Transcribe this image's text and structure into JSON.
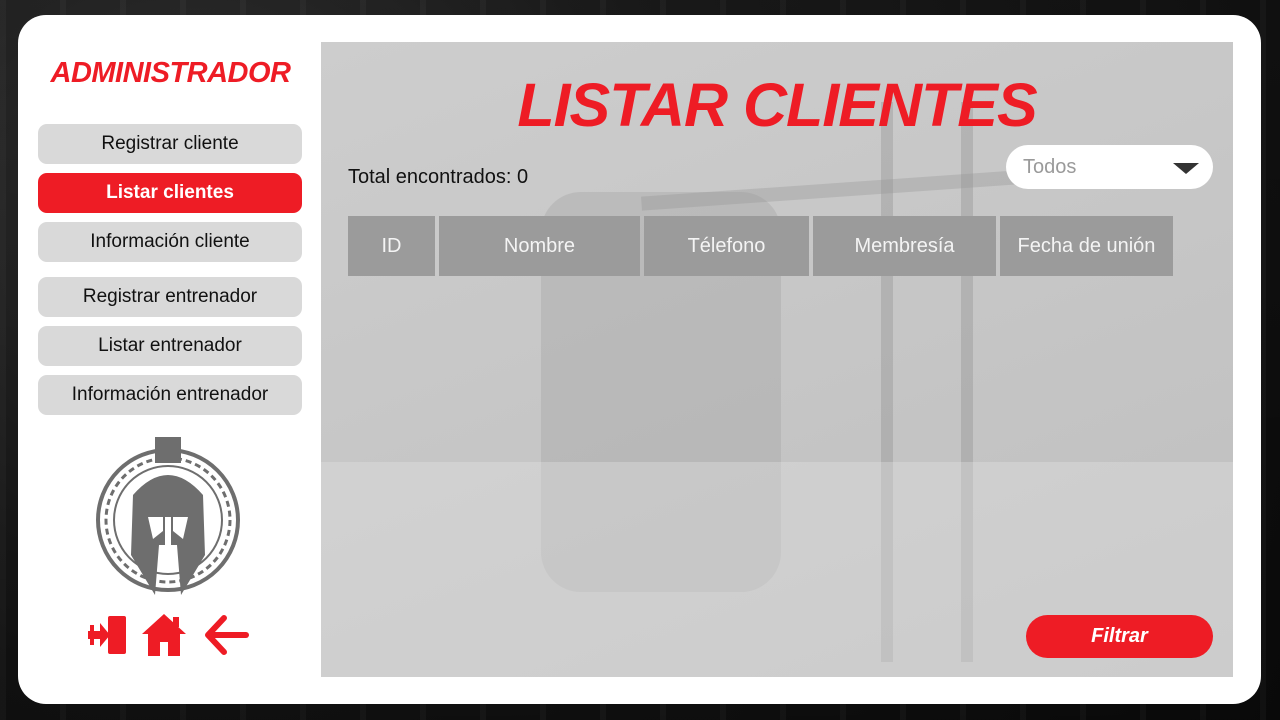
{
  "sidebar": {
    "brand": "ADMINISTRADOR",
    "items": [
      {
        "label": "Registrar cliente",
        "active": false
      },
      {
        "label": "Listar clientes",
        "active": true
      },
      {
        "label": "Información cliente",
        "active": false
      },
      {
        "label": "Registrar entrenador",
        "active": false
      },
      {
        "label": "Listar entrenador",
        "active": false
      },
      {
        "label": "Información entrenador",
        "active": false
      }
    ],
    "logo_icon": "spartan-helmet-icon",
    "bottom_icons": [
      "logout-icon",
      "home-icon",
      "back-arrow-icon"
    ]
  },
  "main": {
    "title": "LISTAR CLIENTES",
    "total_label": "Total encontrados: 0",
    "filter_select": {
      "value": "Todos"
    },
    "table": {
      "columns": [
        "ID",
        "Nombre",
        "Télefono",
        "Membresía",
        "Fecha de unión"
      ],
      "rows": []
    },
    "filter_button": "Filtrar"
  },
  "colors": {
    "accent": "#ee1c25",
    "nav_inactive": "#d9d9d9",
    "table_header": "#9b9b9b",
    "icon_gray": "#6e6e6e"
  }
}
